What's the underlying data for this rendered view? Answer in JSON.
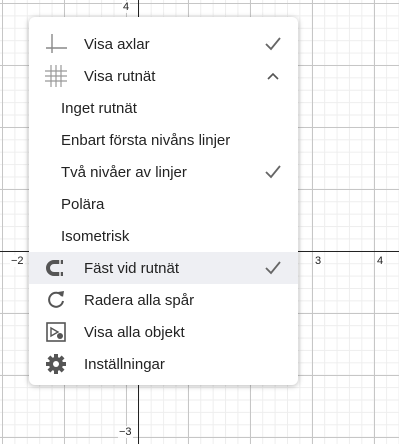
{
  "axes": {
    "x_ticks": [
      {
        "label": "−2"
      },
      {
        "label": "3"
      },
      {
        "label": "4"
      }
    ],
    "y_ticks": [
      {
        "label": "4"
      },
      {
        "label": "−3"
      }
    ]
  },
  "menu": {
    "items": [
      {
        "label": "Visa axlar",
        "icon": "axes-icon",
        "checked": true
      },
      {
        "label": "Visa rutnät",
        "icon": "grid-icon",
        "expanded": true
      },
      {
        "label": "Inget rutnät",
        "sub": true
      },
      {
        "label": "Enbart första nivåns linjer",
        "sub": true
      },
      {
        "label": "Två nivåer av linjer",
        "sub": true,
        "checked": true
      },
      {
        "label": "Polära",
        "sub": true
      },
      {
        "label": "Isometrisk",
        "sub": true
      },
      {
        "label": "Fäst vid rutnät",
        "icon": "magnet-icon",
        "checked": true,
        "highlighted": true
      },
      {
        "label": "Radera alla spår",
        "icon": "refresh-icon"
      },
      {
        "label": "Visa alla objekt",
        "icon": "zoom-to-fit-icon"
      },
      {
        "label": "Inställningar",
        "icon": "gear-icon"
      }
    ]
  },
  "colors": {
    "highlight": "#eeeff3",
    "icon": "#666666",
    "text": "#222222"
  }
}
